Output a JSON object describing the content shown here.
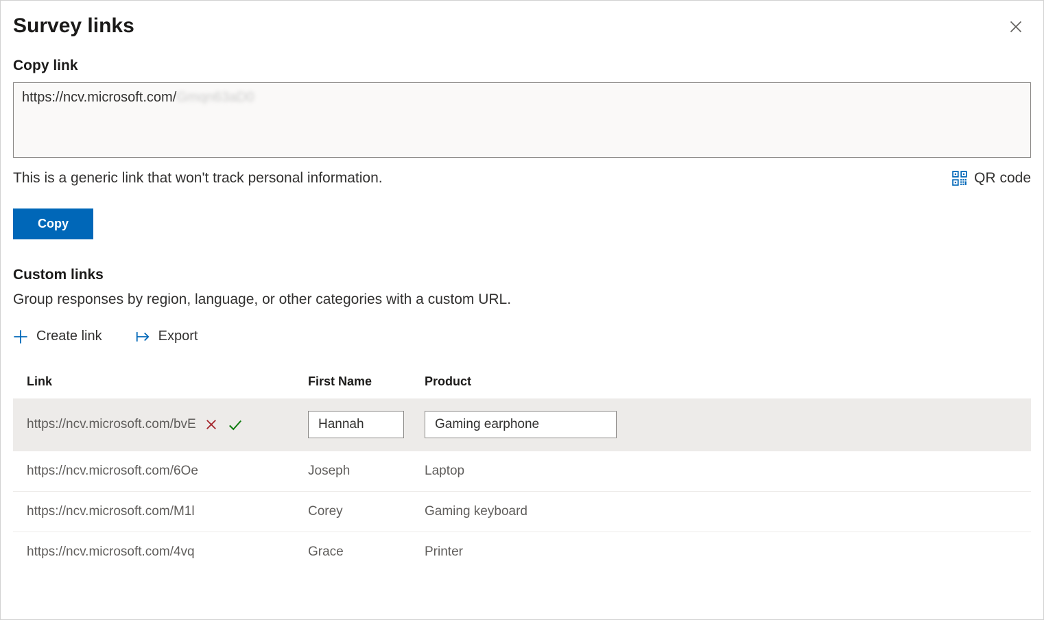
{
  "header": {
    "title": "Survey links"
  },
  "copyLink": {
    "label": "Copy link",
    "urlBase": "https://ncv.microsoft.com/",
    "urlTailBlurred": "Gmqn63aD0",
    "helper": "This is a generic link that won't track personal information.",
    "qrLabel": "QR code",
    "copyButton": "Copy"
  },
  "customLinks": {
    "label": "Custom links",
    "description": "Group responses by region, language, or other categories with a custom URL.",
    "createLink": "Create link",
    "export": "Export",
    "columns": {
      "link": "Link",
      "firstName": "First Name",
      "product": "Product"
    },
    "rows": [
      {
        "link": "https://ncv.microsoft.com/bvE",
        "firstName": "Hannah",
        "product": "Gaming earphone",
        "editing": true
      },
      {
        "link": "https://ncv.microsoft.com/6Oe",
        "firstName": "Joseph",
        "product": "Laptop",
        "editing": false
      },
      {
        "link": "https://ncv.microsoft.com/M1l",
        "firstName": "Corey",
        "product": "Gaming keyboard",
        "editing": false
      },
      {
        "link": "https://ncv.microsoft.com/4vq",
        "firstName": "Grace",
        "product": "Printer",
        "editing": false
      }
    ]
  }
}
